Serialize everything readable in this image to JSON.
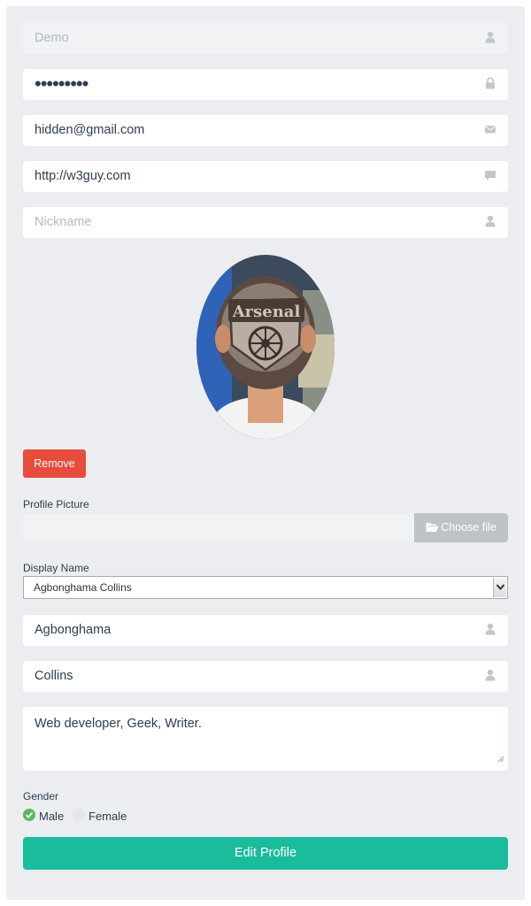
{
  "form": {
    "username": {
      "value": "",
      "placeholder": "Demo",
      "icon": "user-icon"
    },
    "password": {
      "value": "•••••••••",
      "icon": "lock-icon"
    },
    "email": {
      "value": "hidden@gmail.com",
      "icon": "envelope-icon"
    },
    "website": {
      "value": "http://w3guy.com",
      "icon": "comment-icon"
    },
    "nickname": {
      "value": "",
      "placeholder": "Nickname",
      "icon": "user-icon"
    },
    "avatar": {
      "shape": "oval",
      "image_text": "Arsenal"
    },
    "remove_label": "Remove",
    "profile_picture": {
      "label": "Profile Picture",
      "button_label": "Choose file",
      "icon": "folder-open-icon"
    },
    "display_name": {
      "label": "Display Name",
      "selected": "Agbonghama Collins"
    },
    "first_name": {
      "value": "Agbonghama",
      "icon": "user-icon"
    },
    "last_name": {
      "value": "Collins",
      "icon": "user-icon"
    },
    "bio": {
      "value": "Web developer, Geek, Writer."
    },
    "gender": {
      "label": "Gender",
      "options": [
        "Male",
        "Female"
      ],
      "selected": "Male"
    },
    "submit_label": "Edit Profile"
  },
  "colors": {
    "panel": "#ecedf0",
    "remove": "#e74c3c",
    "submit": "#1abc9c",
    "file_button": "#bdc3c7",
    "radio_checked": "#5cb85c"
  }
}
